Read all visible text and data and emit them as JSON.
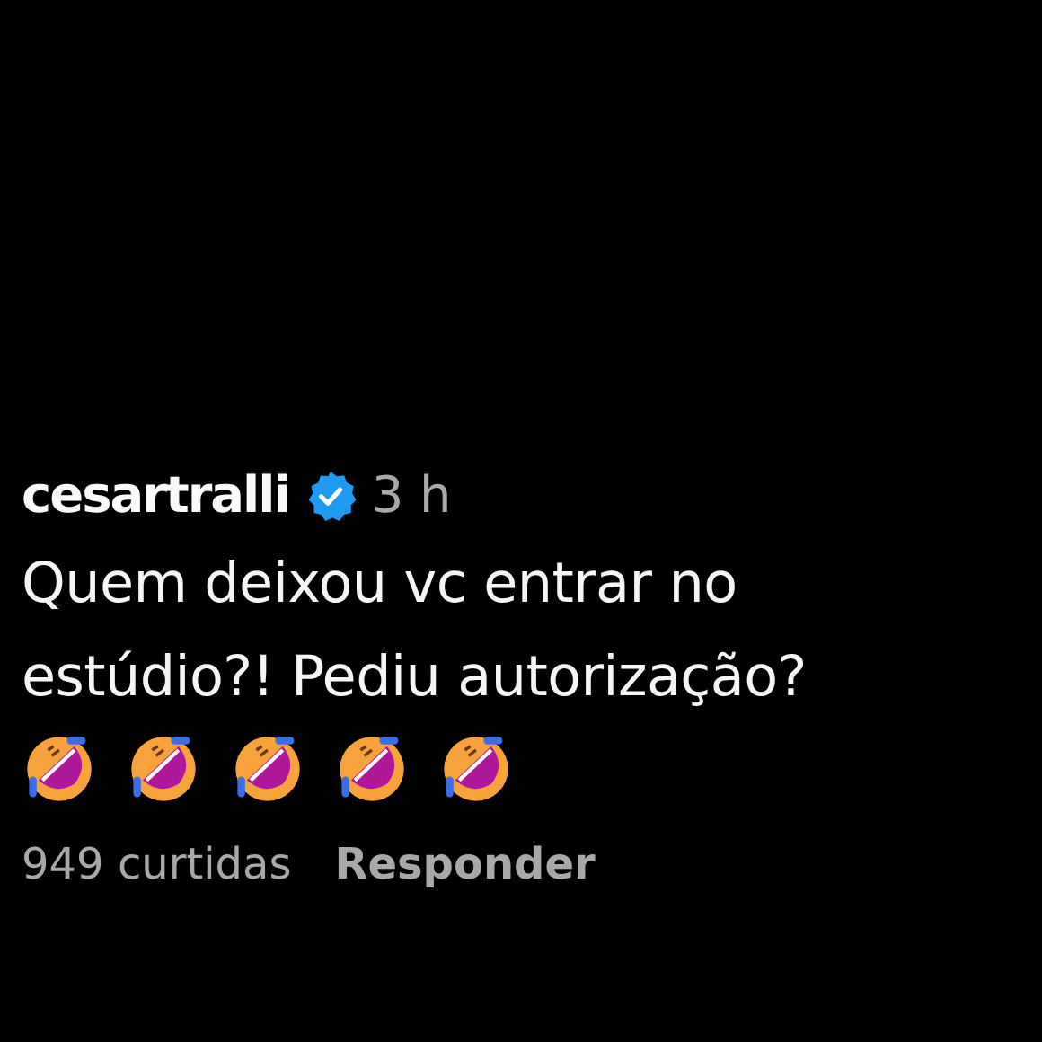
{
  "comment": {
    "username": "cesartralli",
    "verified": true,
    "time": "3 h",
    "text": "Quem deixou vc entrar no estúdio?! Pediu autorização?",
    "emojis": [
      {
        "kind": "rofl"
      },
      {
        "kind": "rofl"
      },
      {
        "kind": "rofl"
      },
      {
        "kind": "rofl"
      },
      {
        "kind": "rofl"
      }
    ],
    "likes": "949 curtidas",
    "reply": "Responder"
  }
}
